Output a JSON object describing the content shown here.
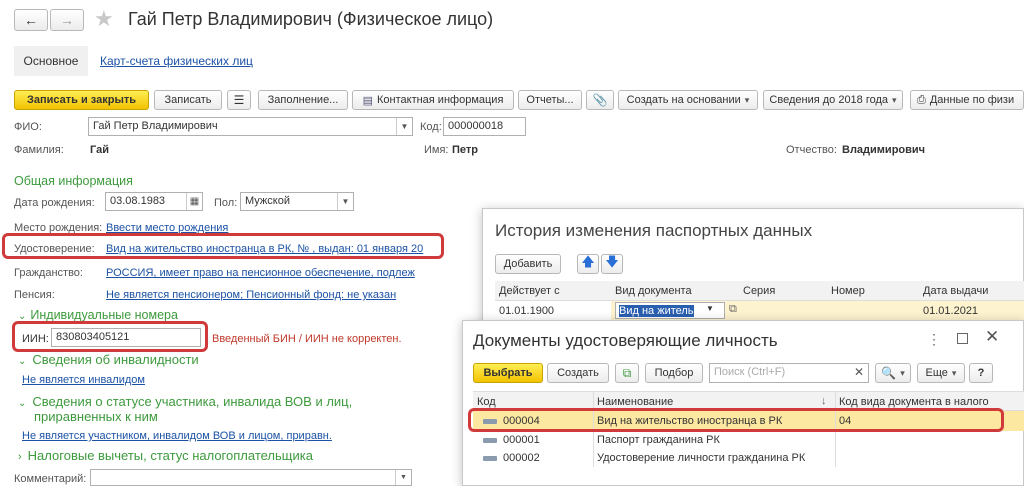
{
  "title": "Гай Петр Владимирович (Физическое лицо)",
  "tabs": [
    "Основное",
    "Карт-счета физических лиц"
  ],
  "toolbar": {
    "save_close": "Записать и закрыть",
    "save": "Записать",
    "fill": "Заполнение...",
    "contact": "Контактная информация",
    "reports": "Отчеты...",
    "create_based": "Создать на основании",
    "info_2018": "Сведения до 2018 года",
    "data_by": "Данные по физи"
  },
  "form": {
    "fio_label": "ФИО:",
    "fio_value": "Гай Петр Владимирович",
    "code_label": "Код:",
    "code_value": "000000018",
    "surname_label": "Фамилия:",
    "surname_value": "Гай",
    "name_label": "Имя:",
    "name_value": "Петр",
    "patronymic_label": "Отчество:",
    "patronymic_value": "Владимирович",
    "general_info": "Общая информация",
    "birthdate_label": "Дата рождения:",
    "birthdate_value": "03.08.1983",
    "gender_label": "Пол:",
    "gender_value": "Мужской",
    "birthplace_label": "Место рождения:",
    "birthplace_link": "Ввести место рождения",
    "id_doc_label": "Удостоверение:",
    "id_doc_link": "Вид на жительство иностранца в РК, № , выдан: 01 января 20",
    "citizenship_label": "Гражданство:",
    "citizenship_link": "РОССИЯ, имеет право на пенсионное обеспечение, подлеж",
    "pension_label": "Пенсия:",
    "pension_link": "Не является пенсионером; Пенсионный фонд: не указан",
    "individual_numbers": "Индивидуальные номера",
    "iin_label": "ИИН:",
    "iin_value": "830803405121",
    "iin_error": "Введенный БИН / ИИН не корректен.",
    "disability_header": "Сведения об инвалидности",
    "disability_link": "Не является инвалидом",
    "status_header_1": "Сведения о статусе участника, инвалида ВОВ и лиц,",
    "status_header_2": "приравненных к ним",
    "status_link": "Не является участником, инвалидом ВОВ и лицом, приравн.",
    "tax_header": "Налоговые вычеты, статус налогоплательщика",
    "comment_label": "Комментарий:"
  },
  "history_window": {
    "title": "История изменения паспортных данных",
    "add_button": "Добавить",
    "columns": [
      "Действует с",
      "Вид документа",
      "Серия",
      "Номер",
      "Дата выдачи"
    ],
    "row": {
      "valid_from": "01.01.1900",
      "doc_type": "Вид на житель",
      "series": "",
      "number": "",
      "issue_date": "01.01.2021"
    }
  },
  "docs_window": {
    "title": "Документы удостоверяющие личность",
    "select_button": "Выбрать",
    "create_button": "Создать",
    "pick_button": "Подбор",
    "search_placeholder": "Поиск (Ctrl+F)",
    "more_button": "Еще",
    "help_button": "?",
    "columns": [
      "Код",
      "Наименование",
      "Код вида документа в налого"
    ],
    "rows": [
      {
        "code": "000004",
        "name": "Вид на жительство иностранца в РК",
        "tax_code": "04"
      },
      {
        "code": "000001",
        "name": "Паспорт гражданина РК",
        "tax_code": ""
      },
      {
        "code": "000002",
        "name": "Удостоверение личности гражданина РК",
        "tax_code": ""
      }
    ]
  },
  "colors": {
    "accent_yellow": "#f2c200",
    "link": "#1c52a5",
    "green": "#3d9a3d",
    "highlight_red": "#d03a3a",
    "row_selected": "#fde8a2"
  }
}
